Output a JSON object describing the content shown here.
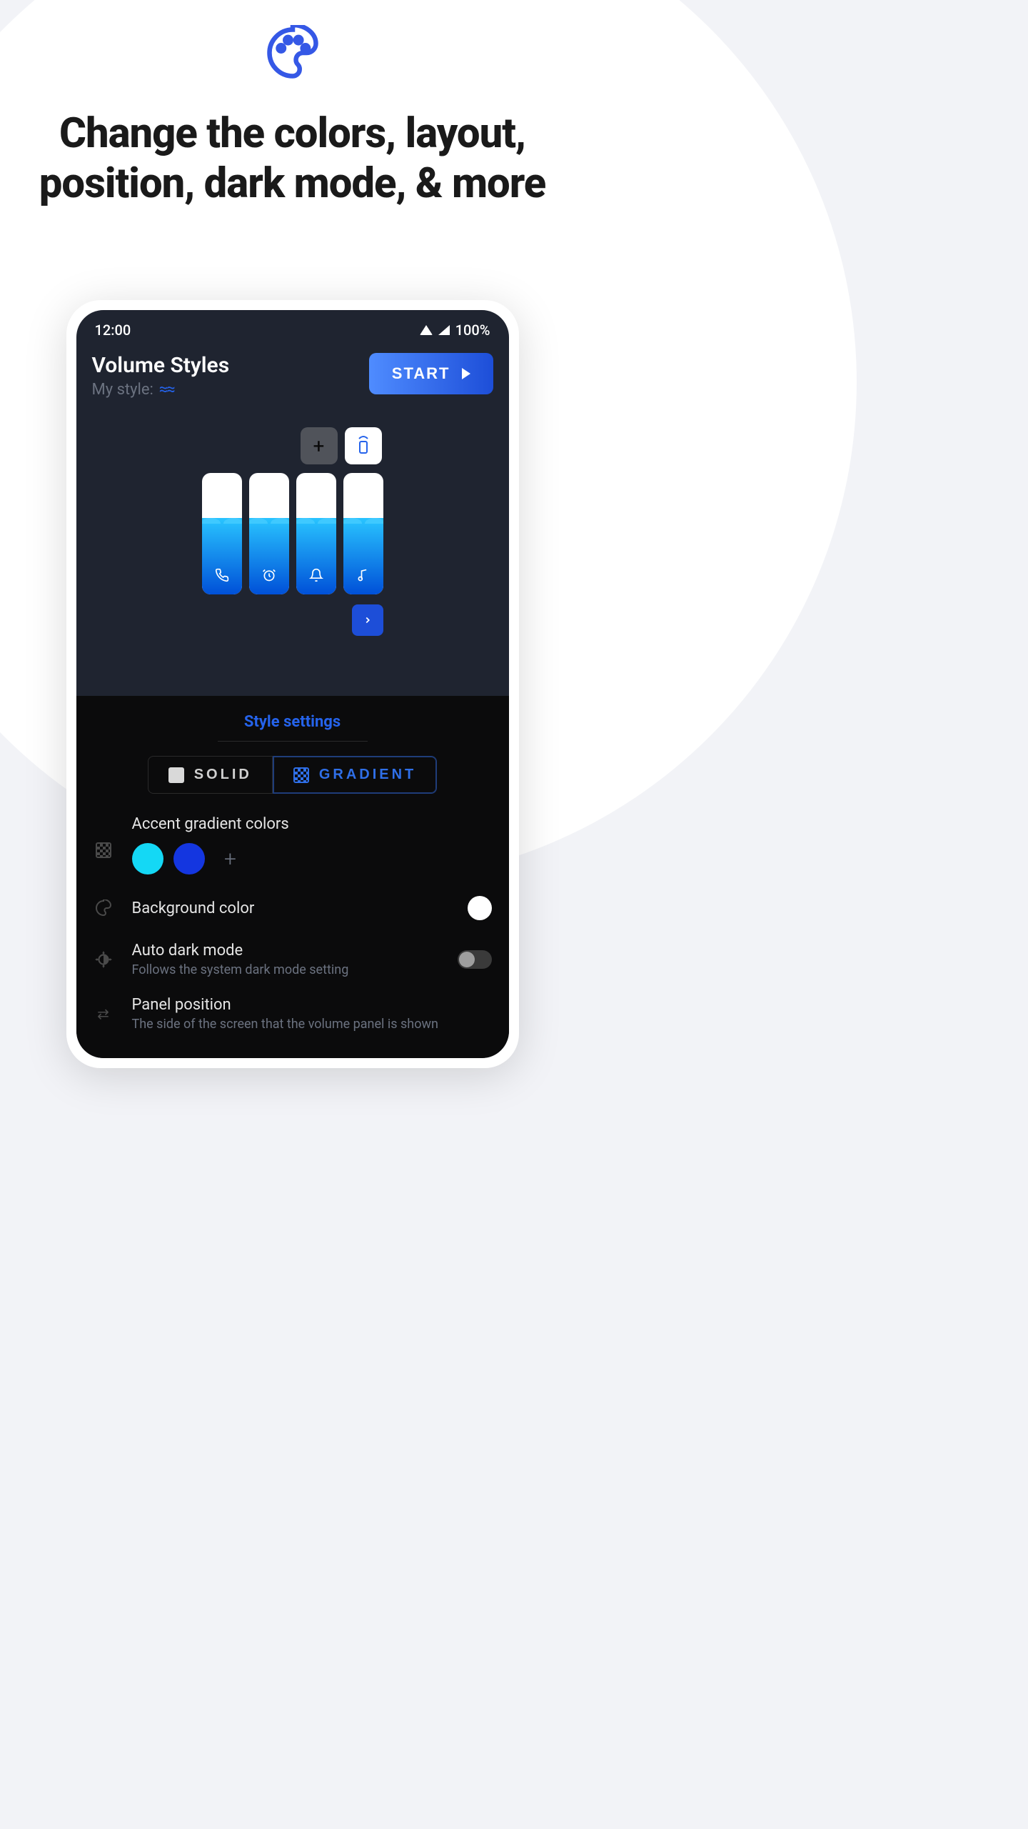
{
  "promo": {
    "headline_line1": "Change the colors, layout,",
    "headline_line2": "position, dark mode, & more"
  },
  "status": {
    "time": "12:00",
    "battery": "100%"
  },
  "app": {
    "title": "Volume Styles",
    "subtitle": "My style:",
    "style_icon_name": "waves-icon",
    "start_label": "START"
  },
  "preview": {
    "add_icon": "plus-icon",
    "second_icon": "remote-speaker-icon",
    "sliders": [
      {
        "icon": "phone-icon",
        "glyph": "📞",
        "fill": 63
      },
      {
        "icon": "alarm-icon",
        "glyph": "⏰",
        "fill": 63
      },
      {
        "icon": "bell-icon",
        "glyph": "🔔",
        "fill": 63
      },
      {
        "icon": "music-icon",
        "glyph": "♪",
        "fill": 63
      }
    ],
    "expand_icon": "chevron-right-icon"
  },
  "sheet": {
    "title": "Style settings",
    "tabs": {
      "solid": "SOLID",
      "gradient": "GRADIENT",
      "active": "gradient"
    },
    "accent": {
      "label": "Accent gradient colors",
      "colors": [
        "#14d8f5",
        "#1436e0"
      ],
      "add_icon": "plus-icon"
    },
    "background": {
      "label": "Background color",
      "value": "#ffffff"
    },
    "dark_mode": {
      "label": "Auto dark mode",
      "sub": "Follows the system dark mode setting",
      "enabled": false
    },
    "panel_position": {
      "label": "Panel position",
      "sub": "The side of the screen that the volume panel is shown"
    }
  },
  "colors": {
    "accent": "#2563eb",
    "gradient_start": "#4f8cff",
    "gradient_end": "#1d4ed8"
  }
}
